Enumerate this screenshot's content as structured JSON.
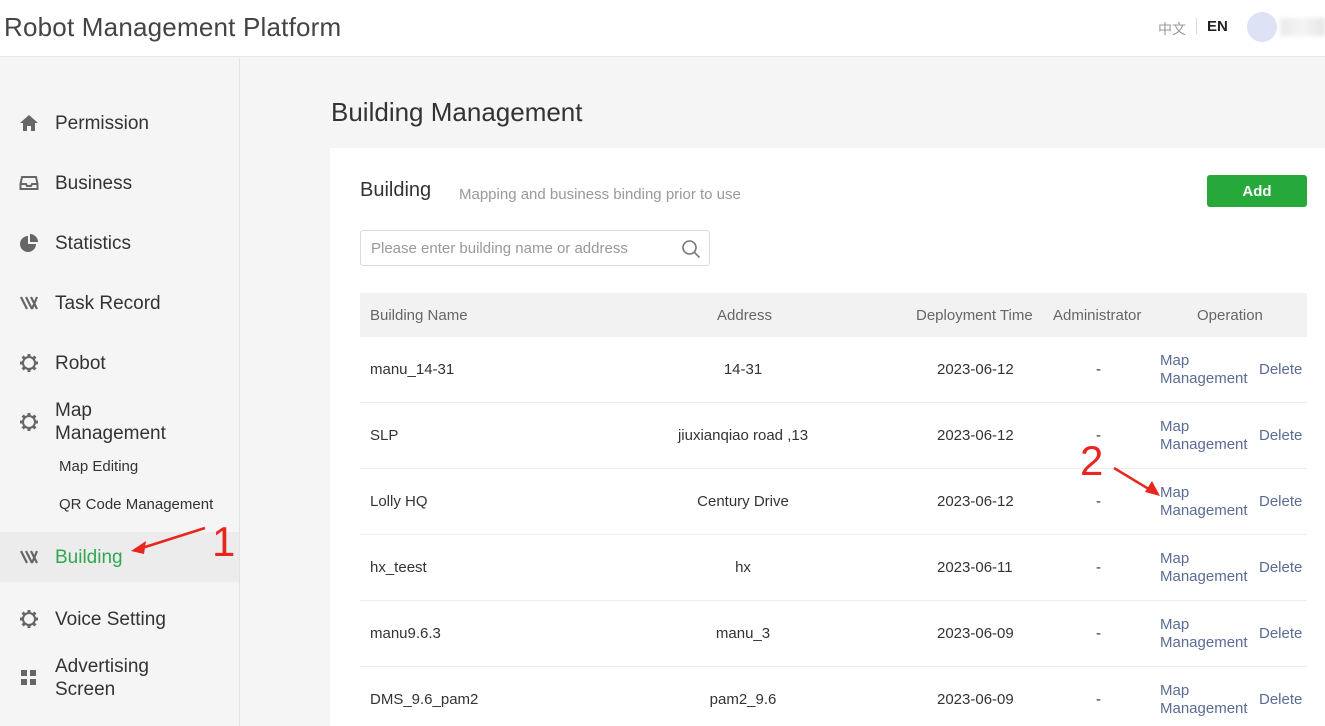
{
  "header": {
    "app_title": "Robot Management Platform",
    "lang_zh": "中文",
    "lang_en": "EN"
  },
  "sidebar": {
    "items": [
      {
        "key": "permission",
        "label": "Permission",
        "icon": "home-icon"
      },
      {
        "key": "business",
        "label": "Business",
        "icon": "inbox-icon"
      },
      {
        "key": "statistics",
        "label": "Statistics",
        "icon": "pie-chart-icon"
      },
      {
        "key": "task-record",
        "label": "Task Record",
        "icon": "task-record-icon"
      },
      {
        "key": "robot",
        "label": "Robot",
        "icon": "gear-icon"
      },
      {
        "key": "map-management",
        "label": "Map Management",
        "icon": "gear-icon"
      },
      {
        "key": "building",
        "label": "Building",
        "icon": "building-icon",
        "active": true
      },
      {
        "key": "voice-setting",
        "label": "Voice Setting",
        "icon": "gear-icon"
      },
      {
        "key": "advertising-screen",
        "label": "Advertising Screen",
        "icon": "grid-icon"
      }
    ],
    "map_sub_items": [
      "Map Editing",
      "QR Code Management"
    ]
  },
  "main": {
    "page_title": "Building Management",
    "card_title": "Building",
    "card_subtitle": "Mapping and business binding prior to use",
    "add_label": "Add",
    "search_placeholder": "Please enter building name or address",
    "columns": [
      "Building Name",
      "Address",
      "Deployment Time",
      "Administrator",
      "Operation"
    ],
    "rows": [
      {
        "name": "manu_14-31",
        "address": "14-31",
        "time": "2023-06-12",
        "admin": "-"
      },
      {
        "name": "SLP",
        "address": "jiuxianqiao road ,13",
        "time": "2023-06-12",
        "admin": "-"
      },
      {
        "name": "Lolly HQ",
        "address": "Century Drive",
        "time": "2023-06-12",
        "admin": "-"
      },
      {
        "name": "hx_teest",
        "address": "hx",
        "time": "2023-06-11",
        "admin": "-"
      },
      {
        "name": "manu9.6.3",
        "address": "manu_3",
        "time": "2023-06-09",
        "admin": "-"
      },
      {
        "name": "DMS_9.6_pam2",
        "address": "pam2_9.6",
        "time": "2023-06-09",
        "admin": "-"
      }
    ],
    "op_map_line1": "Map",
    "op_map_line2": "Management",
    "op_delete": "Delete"
  },
  "annotations": {
    "step1": "1",
    "step2": "2",
    "color": "#e8261f"
  },
  "colors": {
    "accent": "#2fa84f",
    "add_button": "#27a83a",
    "link": "#5a6b94"
  }
}
